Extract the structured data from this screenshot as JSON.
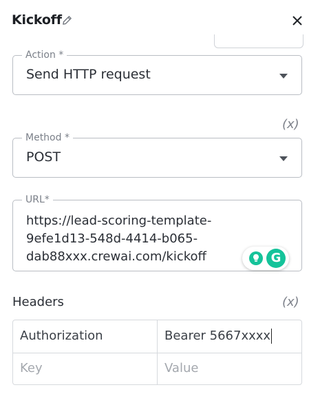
{
  "header": {
    "title": "Kickoff"
  },
  "icons": {
    "edit": "pencil-icon",
    "close": "close-icon",
    "dropdown": "caret-down-icon",
    "variable": "variable-icon",
    "bulb": "lightbulb-icon",
    "grammarly": "grammarly-icon"
  },
  "action": {
    "label": "Action *",
    "value": "Send HTTP request"
  },
  "method": {
    "label": "Method *",
    "value": "POST",
    "variable_button": "(x)"
  },
  "url": {
    "label": "URL*",
    "value": "https://lead-scoring-template-\n9efe1d13-548d-4414-b065-\ndab88xxx.crewai.com/kickoff"
  },
  "grammarly": {
    "letter": "G"
  },
  "headers": {
    "label": "Headers",
    "variable_button": "(x)",
    "rows": [
      {
        "key": "Authorization",
        "value": "Bearer 5667xxxx"
      }
    ],
    "key_placeholder": "Key",
    "value_placeholder": "Value"
  },
  "colors": {
    "accent_green": "#15c39a",
    "border": "#b9bdc3",
    "label_gray": "#7b8089"
  }
}
